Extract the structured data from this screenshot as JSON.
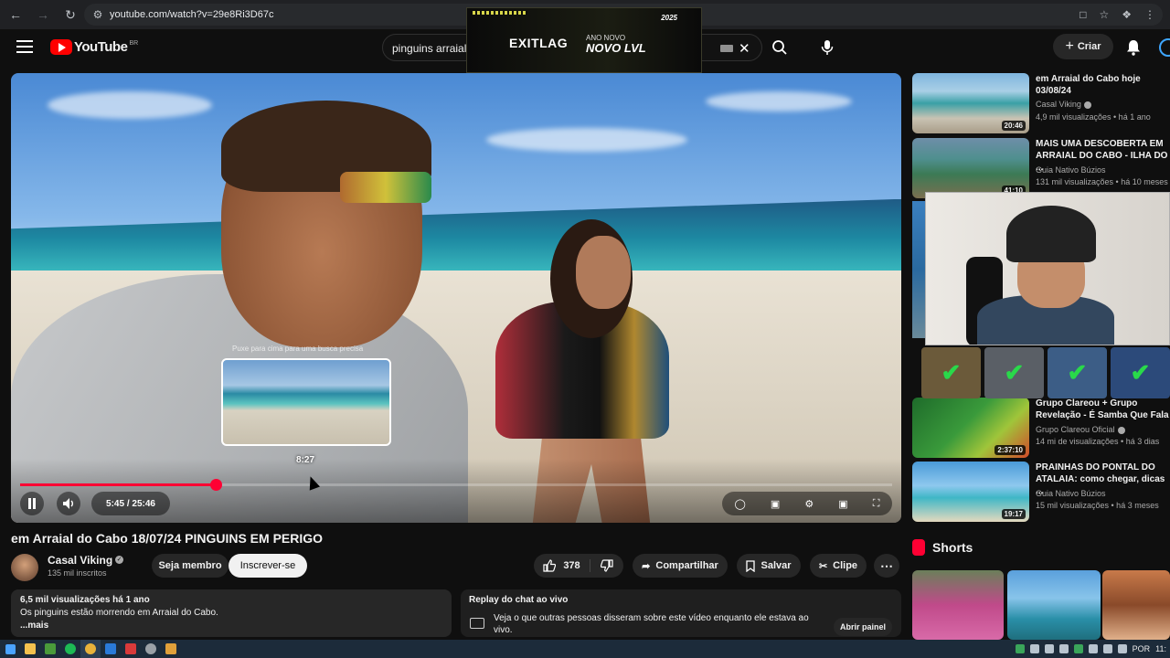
{
  "browser": {
    "url": "youtube.com/watch?v=29e8Ri3D67c"
  },
  "ad": {
    "brand": "EXITLAG",
    "line1": "ANO NOVO",
    "line2": "NOVO LVL",
    "year": "2025"
  },
  "header": {
    "logo_text": "YouTube",
    "country_code": "BR",
    "search_query": "pinguins arraial",
    "create_label": "Criar"
  },
  "player": {
    "preview_hint": "Puxe para cima para uma busca precisa",
    "preview_time": "8:27",
    "time_display": "5:45 / 25:46",
    "progress_fraction": 0.224,
    "hover_fraction": 0.333
  },
  "video": {
    "title": "em Arraial do Cabo 18/07/24 PINGUINS EM PERIGO",
    "channel_name": "Casal Viking",
    "subscribers": "135 mil inscritos",
    "member_label": "Seja membro",
    "subscribe_label": "Inscrever-se",
    "likes": "378",
    "share_label": "Compartilhar",
    "save_label": "Salvar",
    "clip_label": "Clipe"
  },
  "description": {
    "stats": "6,5 mil visualizações  há 1 ano",
    "text": "Os pinguins estão morrendo em Arraial do Cabo.",
    "more": "...mais"
  },
  "chat_replay": {
    "title": "Replay do chat ao vivo",
    "body": "Veja o que outras pessoas disseram sobre este vídeo enquanto ele estava ao vivo.",
    "open_label": "Abrir painel"
  },
  "recommendations": [
    {
      "title": "em Arraial do Cabo hoje 03/08/24",
      "channel": "Casal Viking",
      "meta": "4,9 mil visualizações  •  há 1 ano",
      "duration": "20:46"
    },
    {
      "title": "MAIS UMA DESCOBERTA EM ARRAIAL DO CABO - ILHA DO ...",
      "channel": "Guia Nativo Búzios",
      "meta": "131 mil visualizações  •  há 10 meses",
      "duration": "41:10"
    },
    {
      "title": "Grupo Clareou + Grupo Revelação - É Samba Que Fala",
      "channel": "Grupo Clareou Oficial",
      "meta": "14 mi de visualizações  •  há 3 dias",
      "duration": "2:37:10"
    },
    {
      "title": "PRAINHAS DO PONTAL DO ATALAIA: como chegar, dicas ...",
      "channel": "Guia Nativo Búzios",
      "meta": "15 mil visualizações  •  há 3 meses",
      "duration": "19:17"
    }
  ],
  "shorts": {
    "title": "Shorts"
  },
  "taskbar": {
    "language": "POR",
    "clock": "11:"
  }
}
